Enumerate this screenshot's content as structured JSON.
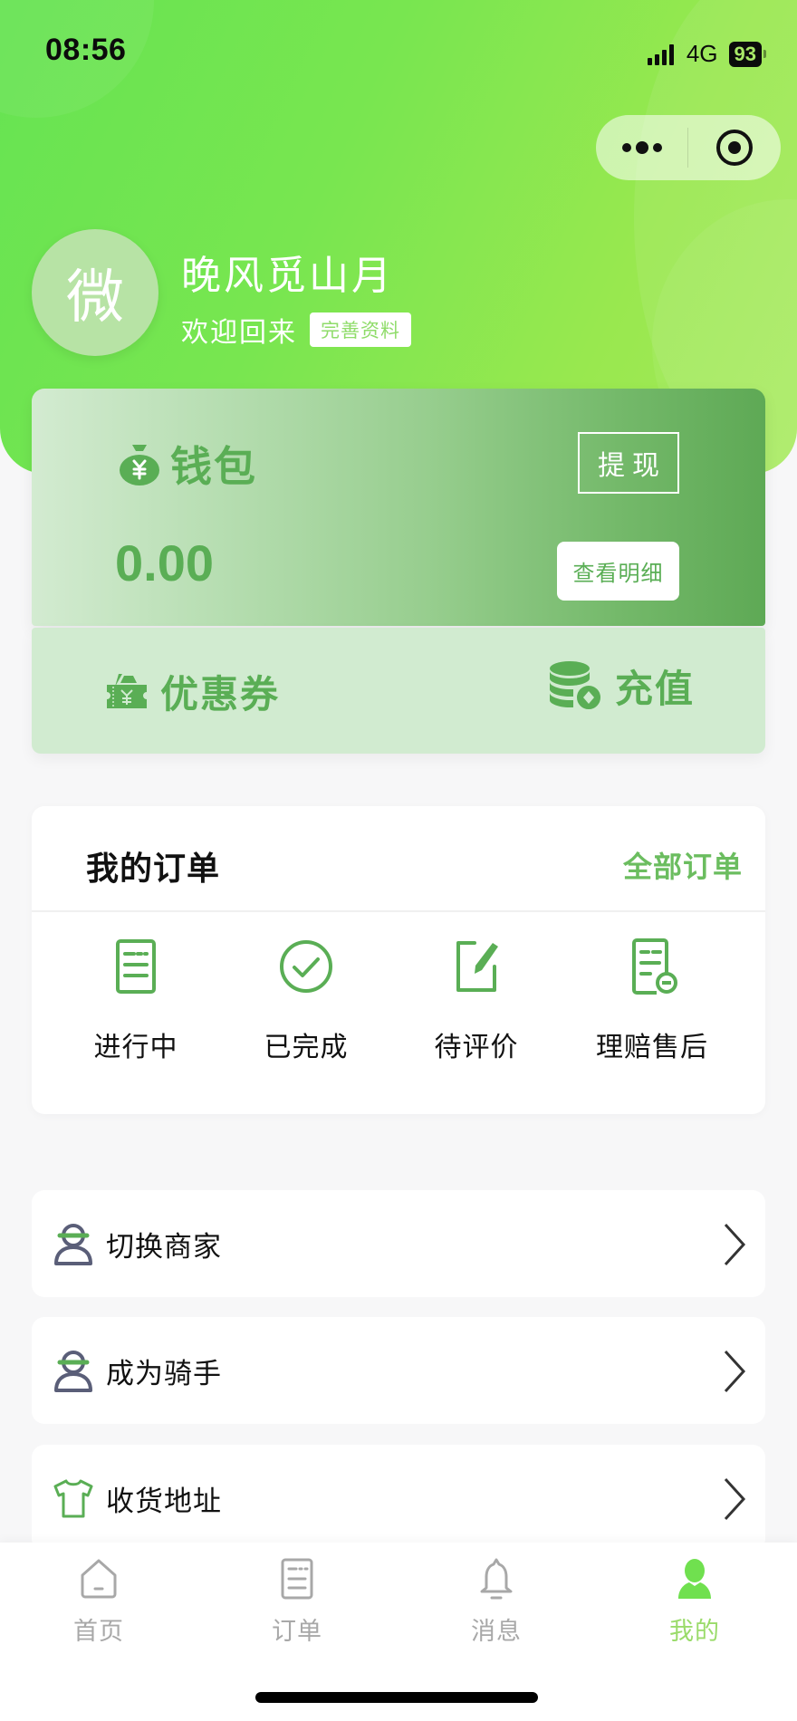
{
  "status_bar": {
    "time": "08:56",
    "network": "4G",
    "battery": "93"
  },
  "capsule": {
    "more_icon": "more-dots-icon",
    "close_icon": "target-circle-icon"
  },
  "profile": {
    "avatar_text": "微",
    "username": "晚风觅山月",
    "welcome": "欢迎回来",
    "complete_label": "完善资料"
  },
  "wallet": {
    "title": "钱包",
    "icon": "money-bag-icon",
    "withdraw_label": "提现",
    "balance": "0.00",
    "detail_label": "查看明细"
  },
  "quick": {
    "coupon": {
      "label": "优惠券",
      "icon": "coupon-icon"
    },
    "recharge": {
      "label": "充值",
      "icon": "coins-icon"
    }
  },
  "orders": {
    "title": "我的订单",
    "all_label": "全部订单",
    "items": [
      {
        "label": "进行中",
        "icon": "list-doc-icon"
      },
      {
        "label": "已完成",
        "icon": "check-circle-icon"
      },
      {
        "label": "待评价",
        "icon": "edit-icon"
      },
      {
        "label": "理赔售后",
        "icon": "doc-minus-icon"
      }
    ]
  },
  "menu": [
    {
      "label": "切换商家",
      "icon": "person-cap-icon"
    },
    {
      "label": "成为骑手",
      "icon": "person-cap-icon"
    },
    {
      "label": "收货地址",
      "icon": "tshirt-icon"
    }
  ],
  "tabbar": {
    "items": [
      {
        "label": "首页",
        "icon": "home-icon",
        "active": false
      },
      {
        "label": "订单",
        "icon": "order-list-icon",
        "active": false
      },
      {
        "label": "消息",
        "icon": "bell-icon",
        "active": false
      },
      {
        "label": "我的",
        "icon": "user-icon",
        "active": true
      }
    ]
  },
  "colors": {
    "brand_green": "#5aae55",
    "header_green": "#78e650",
    "active_tab": "#9adb6a",
    "inactive_tab": "#a8a8a8"
  }
}
